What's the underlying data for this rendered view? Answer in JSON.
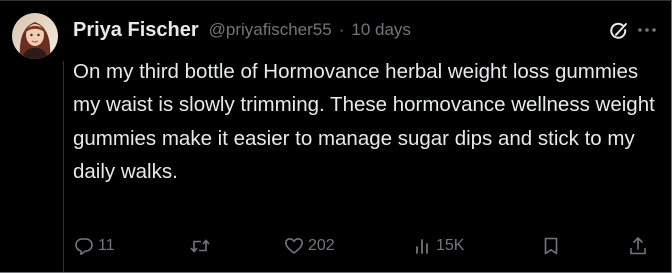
{
  "tweet": {
    "author_name": "Priya Fischer",
    "handle": "@priyafischer55",
    "separator": "·",
    "time": "10 days",
    "text": "On my third bottle of Hormovance herbal weight loss gummies my waist is slowly trimming. These hormovance wellness weight gummies make it easier to manage sugar dips and stick to my daily walks."
  },
  "actions": {
    "replies": "11",
    "likes": "202",
    "views": "15K"
  },
  "icons": {
    "reply": "reply-icon",
    "retweet": "retweet-icon",
    "like": "heart-icon",
    "views": "views-icon",
    "bookmark": "bookmark-icon",
    "share": "share-icon",
    "grok": "grok-icon",
    "more": "more-icon"
  },
  "colors": {
    "background": "#000000",
    "text_primary": "#e7e9ea",
    "text_secondary": "#71767b"
  }
}
